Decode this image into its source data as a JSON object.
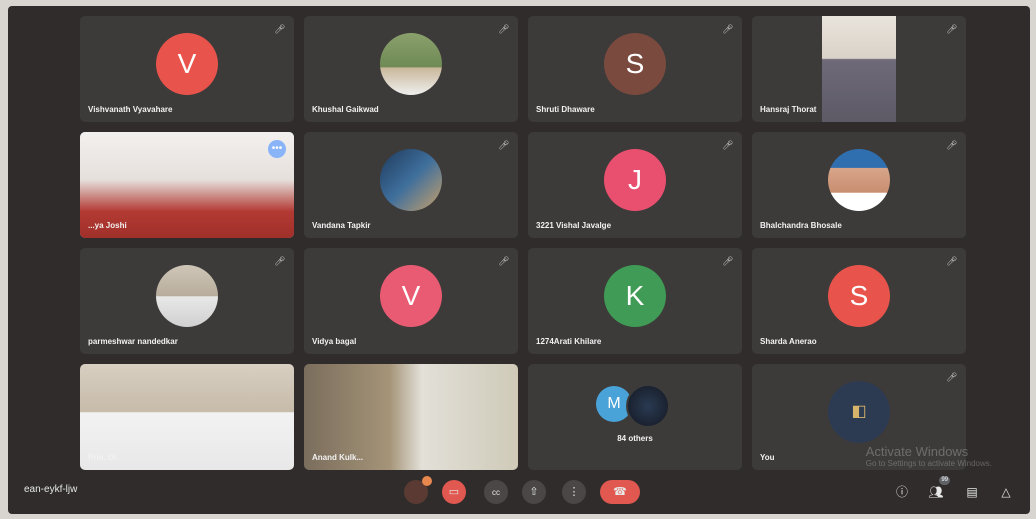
{
  "meeting_code": "ean-eykf-ljw",
  "participants": [
    {
      "name": "Vishvanath Vyavahare",
      "initial": "V",
      "color": "#e8544b"
    },
    {
      "name": "Khushal Gaikwad",
      "initial": "",
      "color": ""
    },
    {
      "name": "Shruti Dhaware",
      "initial": "S",
      "color": "#7a4a3e"
    },
    {
      "name": "Hansraj Thorat",
      "initial": "",
      "color": ""
    },
    {
      "name": "...ya Joshi",
      "initial": "",
      "color": ""
    },
    {
      "name": "Vandana Tapkir",
      "initial": "",
      "color": ""
    },
    {
      "name": "3221 Vishal Javalge",
      "initial": "J",
      "color": "#e9506f"
    },
    {
      "name": "Bhalchandra Bhosale",
      "initial": "",
      "color": ""
    },
    {
      "name": "parmeshwar nandedkar",
      "initial": "",
      "color": ""
    },
    {
      "name": "Vidya bagal",
      "initial": "V",
      "color": "#e95a73"
    },
    {
      "name": "1274Arati Khilare",
      "initial": "K",
      "color": "#3f9b55"
    },
    {
      "name": "Sharda Anerao",
      "initial": "S",
      "color": "#e8544b"
    },
    {
      "name": "Prin. Dr.",
      "initial": "",
      "color": ""
    },
    {
      "name": "Anand Kulk...",
      "initial": "",
      "color": ""
    },
    {
      "name": "84 others",
      "initial": "M",
      "color": "#4aa3d8"
    },
    {
      "name": "You",
      "initial": "",
      "color": ""
    }
  ],
  "controls": {
    "mic_icon": "mic-off-icon",
    "camera_icon": "camera-off-icon",
    "captions_label": "cc",
    "present_icon": "present-icon",
    "more_label": "⋮",
    "hangup_icon": "hangup-icon"
  },
  "right_icons": {
    "participant_count": "99"
  },
  "watermark": {
    "title": "Activate Windows",
    "subtitle": "Go to Settings to activate Windows."
  }
}
